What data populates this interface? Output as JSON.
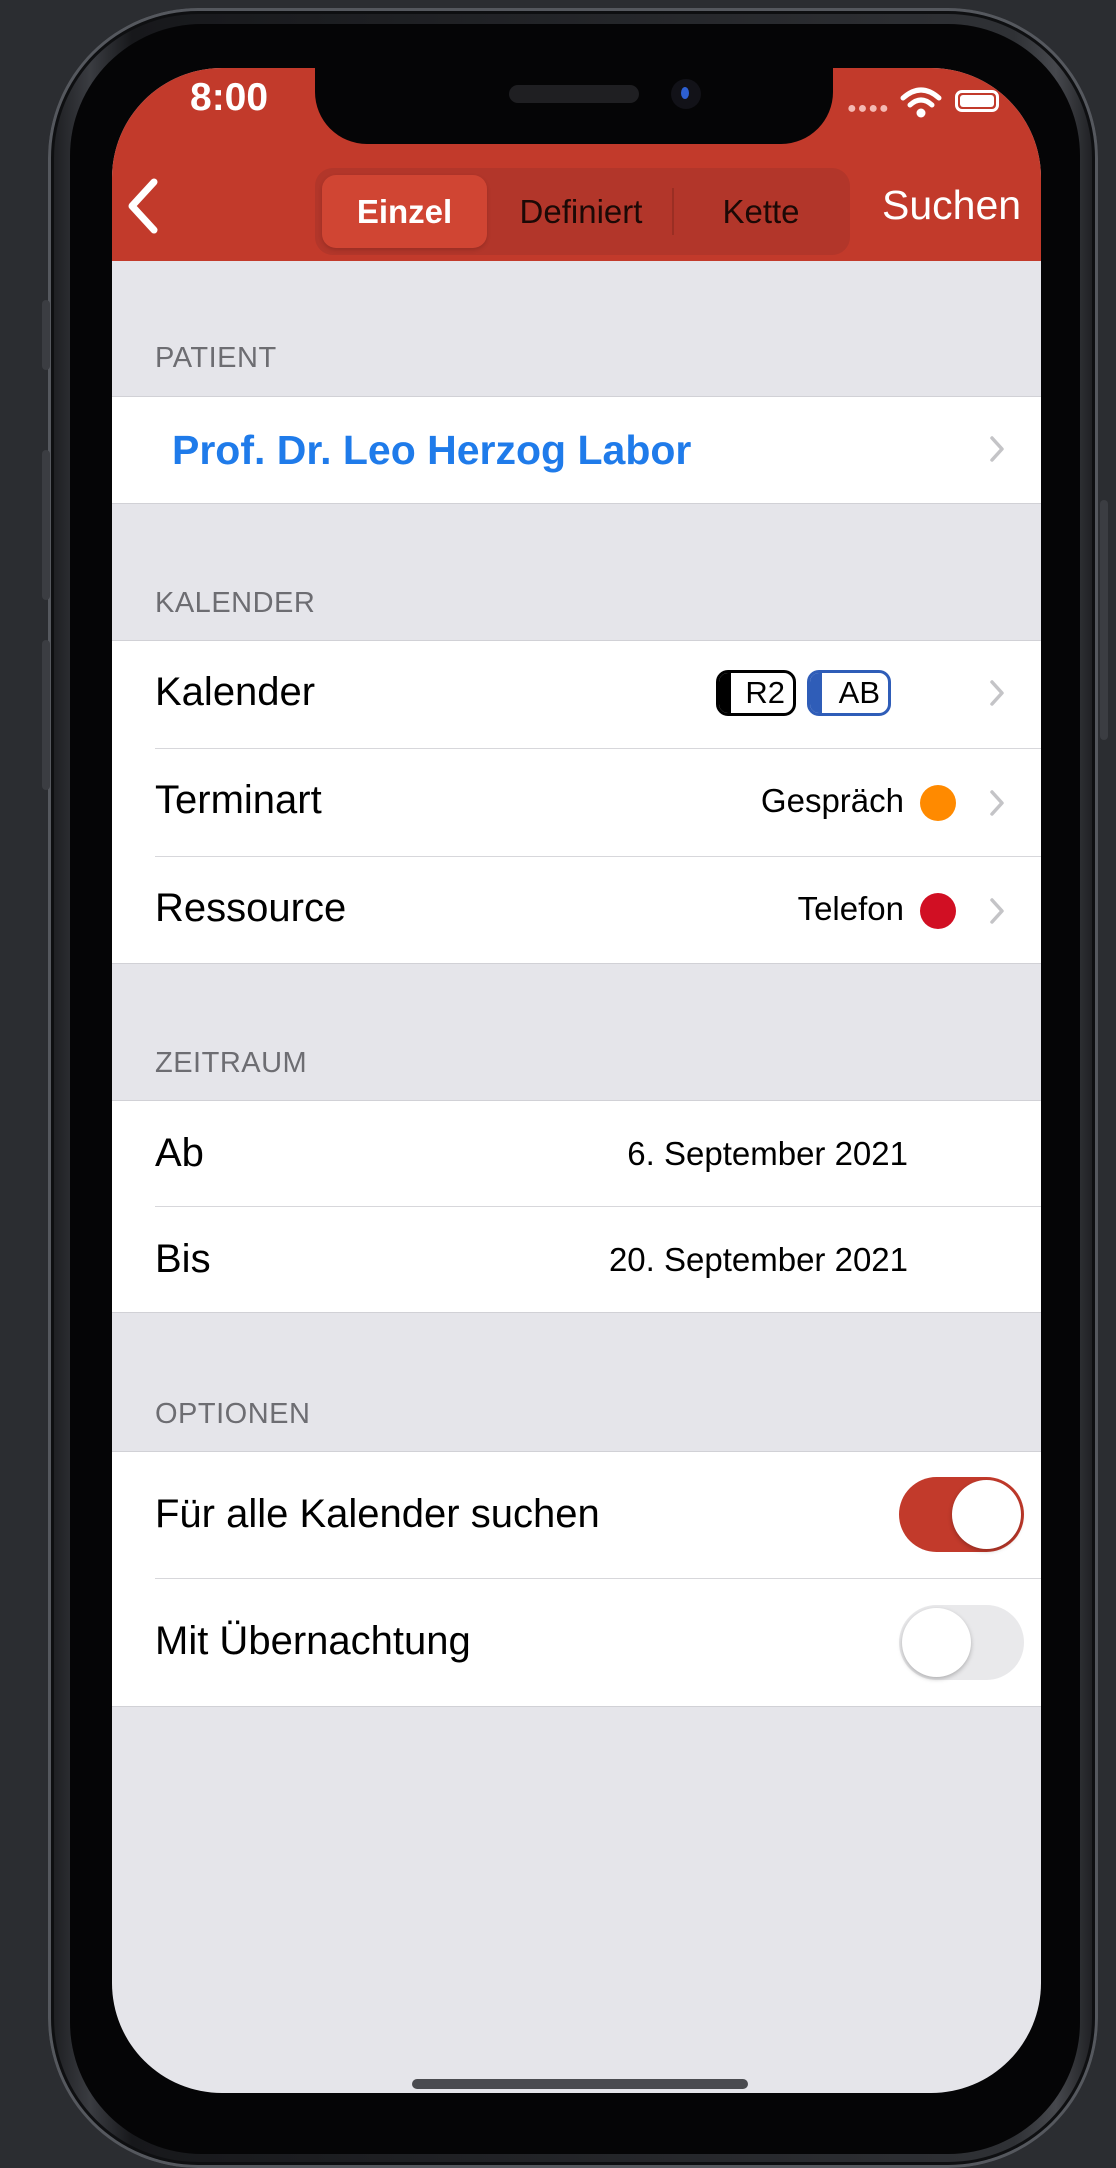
{
  "status_bar": {
    "time": "8:00"
  },
  "nav": {
    "segments": [
      "Einzel",
      "Definiert",
      "Kette"
    ],
    "active_segment": "Einzel",
    "search_label": "Suchen",
    "accent_color": "#c23a2b"
  },
  "patient": {
    "section_title": "PATIENT",
    "name": "Prof. Dr. Leo Herzog Labor"
  },
  "kalender": {
    "section_title": "KALENDER",
    "rows": {
      "kalender": {
        "label": "Kalender",
        "badges": [
          "R2",
          "AB"
        ]
      },
      "terminart": {
        "label": "Terminart",
        "value": "Gespräch",
        "color": "#ff8a00"
      },
      "ressource": {
        "label": "Ressource",
        "value": "Telefon",
        "color": "#d10f23"
      }
    }
  },
  "zeitraum": {
    "section_title": "ZEITRAUM",
    "ab": {
      "label": "Ab",
      "value": "6. September 2021"
    },
    "bis": {
      "label": "Bis",
      "value": "20. September 2021"
    }
  },
  "optionen": {
    "section_title": "OPTIONEN",
    "alle_kalender": {
      "label": "Für alle Kalender suchen",
      "on": true
    },
    "uebernachtung": {
      "label": "Mit Übernachtung",
      "on": false
    }
  }
}
